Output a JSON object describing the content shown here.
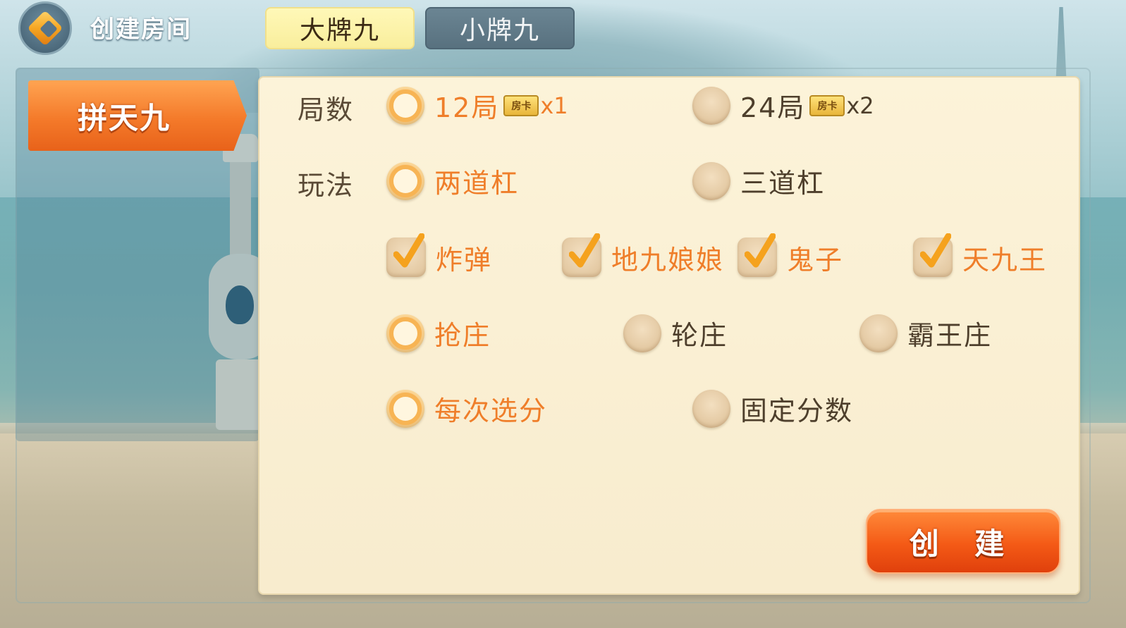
{
  "header": {
    "title": "创建房间",
    "tabs": [
      {
        "label": "大牌九",
        "active": true
      },
      {
        "label": "小牌九",
        "active": false
      }
    ]
  },
  "sidebar": {
    "game_tab": "拼天九"
  },
  "form": {
    "rounds": {
      "label": "局数",
      "options": [
        {
          "label": "12局",
          "card_icon_text": "房卡",
          "cost": "x1",
          "selected": true
        },
        {
          "label": "24局",
          "card_icon_text": "房卡",
          "cost": "x2",
          "selected": false
        }
      ]
    },
    "play": {
      "label": "玩法",
      "bars": [
        {
          "label": "两道杠",
          "selected": true
        },
        {
          "label": "三道杠",
          "selected": false
        }
      ],
      "extras": [
        {
          "label": "炸弹",
          "checked": true
        },
        {
          "label": "地九娘娘",
          "checked": true
        },
        {
          "label": "鬼子",
          "checked": true
        },
        {
          "label": "天九王",
          "checked": true
        }
      ],
      "banker": [
        {
          "label": "抢庄",
          "selected": true
        },
        {
          "label": "轮庄",
          "selected": false
        },
        {
          "label": "霸王庄",
          "selected": false
        }
      ],
      "score": [
        {
          "label": "每次选分",
          "selected": true
        },
        {
          "label": "固定分数",
          "selected": false
        }
      ]
    }
  },
  "create_button": "创 建",
  "colors": {
    "accent_orange": "#ef7e2a",
    "text_dark": "#4e3f2c",
    "card_bg": "#fcf3d9"
  }
}
